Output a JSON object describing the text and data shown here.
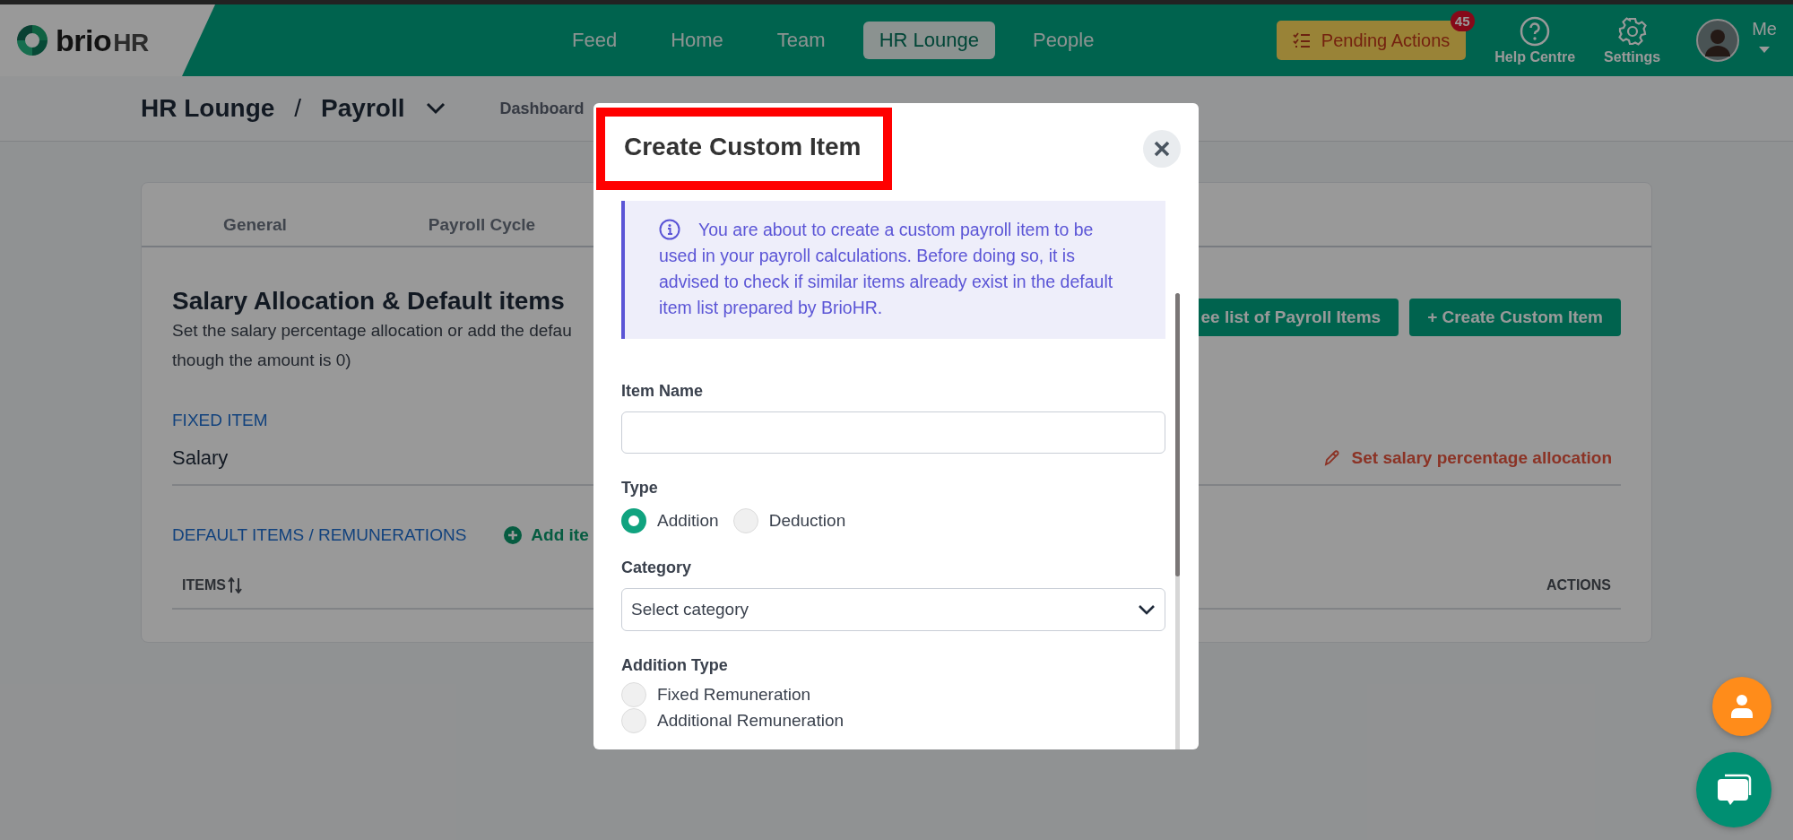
{
  "header": {
    "logo": "brio",
    "logo_suffix": "HR",
    "nav": [
      {
        "label": "Feed",
        "selected": false
      },
      {
        "label": "Home",
        "selected": false
      },
      {
        "label": "Team",
        "selected": false
      },
      {
        "label": "HR Lounge",
        "selected": true
      },
      {
        "label": "People",
        "selected": false
      }
    ],
    "pending": {
      "label": "Pending Actions",
      "badge": "45"
    },
    "tools": [
      {
        "label": "Help Centre",
        "kind": "help"
      },
      {
        "label": "Settings",
        "kind": "settings"
      }
    ],
    "user": {
      "label": "Me"
    }
  },
  "breadcrumb": {
    "section": "HR Lounge",
    "separator": "/",
    "page": "Payroll",
    "link": "Dashboard"
  },
  "card": {
    "tabs": [
      {
        "label": "General",
        "selected": false
      },
      {
        "label": "Payroll Cycle",
        "selected": false
      }
    ],
    "title": "Salary Allocation & Default items",
    "description_lines": [
      "Set the salary percentage allocation or add the defau",
      "though the amount is 0)"
    ],
    "buttons": [
      "ee list of Payroll Items",
      "+ Create Custom Item"
    ],
    "fixed": {
      "heading": "FIXED ITEM",
      "item": "Salary",
      "action": "Set salary percentage allocation"
    },
    "defaults": {
      "heading": "DEFAULT ITEMS / REMUNERATIONS",
      "add": "Add ite",
      "columns": [
        "ITEMS",
        "ACTIONS"
      ]
    }
  },
  "modal": {
    "title": "Create Custom Item",
    "title_highlighted": true,
    "info": "You are about to create a custom payroll item to be used in your payroll calculations. Before doing so, it is advised to check if similar items already exist in the default item list prepared by BrioHR.",
    "item_name_label": "Item Name",
    "type_label": "Type",
    "type_options": [
      {
        "label": "Addition",
        "selected": true
      },
      {
        "label": "Deduction",
        "selected": false
      }
    ],
    "category_label": "Category",
    "category": {
      "placeholder": "Select category"
    },
    "addition_type_label": "Addition Type",
    "addition_type_options": [
      {
        "label": "Fixed Remuneration",
        "selected": false
      },
      {
        "label": "Additional Remuneration",
        "selected": false
      }
    ]
  }
}
